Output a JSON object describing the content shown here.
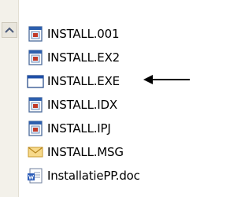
{
  "scrollbar": {
    "up_icon": "chevron-up-icon"
  },
  "files": [
    {
      "name": "INSTALL.001",
      "icon": "app-file-icon"
    },
    {
      "name": "INSTALL.EX2",
      "icon": "app-file-icon"
    },
    {
      "name": "INSTALL.EXE",
      "icon": "exe-window-icon",
      "highlighted_by_arrow": true
    },
    {
      "name": "INSTALL.IDX",
      "icon": "app-file-icon"
    },
    {
      "name": "INSTALL.IPJ",
      "icon": "app-file-icon"
    },
    {
      "name": "INSTALL.MSG",
      "icon": "envelope-icon"
    },
    {
      "name": "InstallatiePP.doc",
      "icon": "word-document-icon"
    }
  ],
  "annotation": {
    "icon": "left-arrow-icon",
    "color": "#000000"
  }
}
